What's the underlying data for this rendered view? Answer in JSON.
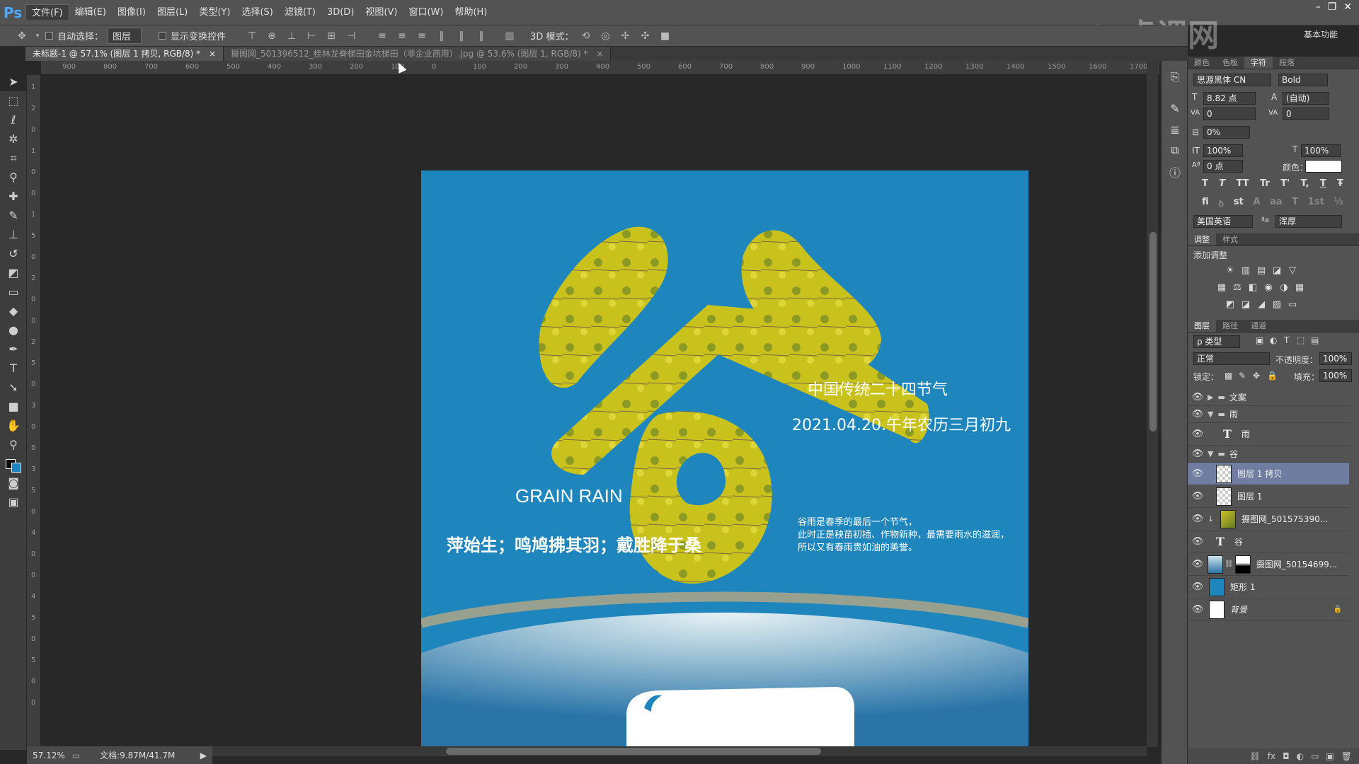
{
  "app": {
    "logo": "Ps"
  },
  "menu": [
    "文件(F)",
    "编辑(E)",
    "图像(I)",
    "图层(L)",
    "类型(Y)",
    "选择(S)",
    "滤镜(T)",
    "3D(D)",
    "视图(V)",
    "窗口(W)",
    "帮助(H)"
  ],
  "window_controls": [
    "–",
    "❐",
    "✕"
  ],
  "workspace": "基本功能",
  "watermark_text": "虎课网",
  "options": {
    "auto_select_label": "自动选择：",
    "auto_select_value": "图层",
    "show_transform_label": "显示变换控件",
    "mode_3d_label": "3D 模式："
  },
  "tabs": [
    {
      "label": "未标题-1 @ 57.1% (图层 1 拷贝, RGB/8) *",
      "close": "×"
    },
    {
      "label": "摄图网_501396512_桂林龙脊梯田金坑梯田（非企业商用）.jpg @ 53.6% (图层 1, RGB/8) *",
      "close": "×"
    }
  ],
  "ruler_h": [
    "900",
    "800",
    "700",
    "600",
    "500",
    "400",
    "300",
    "200",
    "100",
    "0",
    "100",
    "200",
    "300",
    "400",
    "500",
    "600",
    "700",
    "800",
    "900",
    "1000",
    "1100",
    "1200",
    "1300",
    "1400",
    "1500",
    "1600",
    "1700"
  ],
  "ruler_v": [
    "1",
    "2",
    "0",
    "1",
    "0",
    "0",
    "1",
    "5",
    "0",
    "2",
    "0",
    "0",
    "2",
    "5",
    "0",
    "3",
    "0",
    "0",
    "3",
    "5",
    "0",
    "4",
    "0",
    "0",
    "4",
    "5",
    "0",
    "5",
    "0",
    "0"
  ],
  "status": {
    "zoom": "57.12%",
    "doc": "文档:9.87M/41.7M"
  },
  "artwork": {
    "title_cn": "中国传统二十四节气",
    "date_line": "2021.04.20.午年农历三月初九",
    "grain_rain": "GRAIN RAIN",
    "poem": "萍始生；鸣鸠拂其羽；戴胜降于桑",
    "desc_1": "谷雨是春季的最后一个节气，",
    "desc_2": "此时正是秧苗初插、作物新种，最需要雨水的滋润，",
    "desc_3": "所以又有春雨贵如油的美誉。",
    "big_char": "谷"
  },
  "char_panel": {
    "tabs": [
      "颜色",
      "色板",
      "字符",
      "段落"
    ],
    "font_family": "思源黑体 CN",
    "font_style": "Bold",
    "font_size": "8.82 点",
    "leading": "(自动)",
    "kerning": "0",
    "tracking": "0",
    "scale_pct": "0%",
    "vscale": "100%",
    "hscale": "100%",
    "baseline": "0 点",
    "color_label": "颜色：",
    "language": "美国英语",
    "aa_label": "ªa",
    "aa_mode": "浑厚",
    "style_buttons": [
      "T",
      "T",
      "TT",
      "Tr",
      "T'",
      "T,",
      "T",
      "Ŧ"
    ],
    "ot_buttons": [
      "fi",
      "ꝺ",
      "st",
      "A",
      "aa",
      "T",
      "1st",
      "½"
    ]
  },
  "adjust_panel": {
    "tabs": [
      "调整",
      "样式"
    ],
    "title": "添加调整",
    "icons_row1": [
      "☀",
      "▥",
      "▤",
      "◪",
      "▽"
    ],
    "icons_row2": [
      "▦",
      "⚖",
      "◧",
      "◉",
      "◑",
      "▦"
    ],
    "icons_row3": [
      "◩",
      "◪",
      "◢",
      "▨",
      "▭"
    ]
  },
  "layers_panel": {
    "tabs": [
      "图层",
      "路径",
      "通道"
    ],
    "filter_label": "ρ 类型",
    "blend_mode": "正常",
    "opacity_label": "不透明度：",
    "opacity": "100%",
    "lock_label": "锁定：",
    "fill_label": "填充：",
    "fill": "100%",
    "layers": [
      {
        "name": "文案",
        "kind": "group",
        "arrow": "▶"
      },
      {
        "name": "雨",
        "kind": "group",
        "arrow": "▼"
      },
      {
        "name": "雨",
        "kind": "text",
        "glyph": "T"
      },
      {
        "name": "谷",
        "kind": "group",
        "arrow": "▼"
      },
      {
        "name": "图层 1 拷贝",
        "kind": "pixel",
        "selected": true
      },
      {
        "name": "图层 1",
        "kind": "pixel"
      },
      {
        "name": "摄图网_501575390...",
        "kind": "photo"
      },
      {
        "name": "谷",
        "kind": "text",
        "glyph": "T"
      },
      {
        "name": "摄图网_50154699...",
        "kind": "masked"
      },
      {
        "name": "矩形 1",
        "kind": "shape"
      },
      {
        "name": "背景",
        "kind": "background",
        "lock": "🔒"
      }
    ],
    "bottom_icons": [
      "⛓",
      "fx",
      "◘",
      "◐",
      "▭",
      "▣",
      "🗑"
    ]
  },
  "colors": {
    "poster_bg": "#1e86bd",
    "ps_blue": "#4aa8ff",
    "field_yellow": "#c9c21d",
    "selected_layer": "#6f7ea0"
  }
}
